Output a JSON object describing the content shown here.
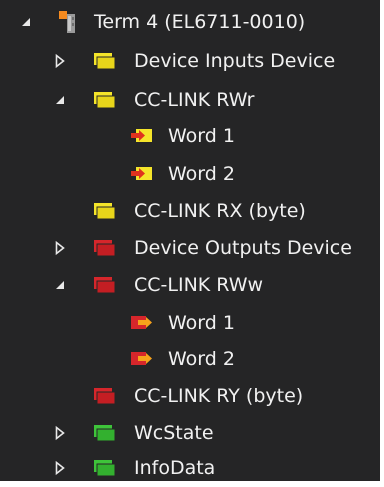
{
  "tree": {
    "root": {
      "label": "Term 4 (EL6711-0010)",
      "expanded": true,
      "icon": "terminal-icon"
    },
    "items": [
      {
        "label": "Device Inputs Device",
        "expanded": false,
        "icon": "yellow-folder-icon"
      },
      {
        "label": "CC-LINK RWr",
        "expanded": true,
        "icon": "yellow-folder-icon"
      },
      {
        "label": "Word 1",
        "icon": "input-variable-icon"
      },
      {
        "label": "Word 2",
        "icon": "input-variable-icon"
      },
      {
        "label": "CC-LINK RX (byte)",
        "icon": "yellow-folder-icon"
      },
      {
        "label": "Device Outputs Device",
        "expanded": false,
        "icon": "red-folder-icon"
      },
      {
        "label": "CC-LINK RWw",
        "expanded": true,
        "icon": "red-folder-icon"
      },
      {
        "label": "Word 1",
        "icon": "output-variable-icon"
      },
      {
        "label": "Word 2",
        "icon": "output-variable-icon"
      },
      {
        "label": "CC-LINK RY (byte)",
        "icon": "red-folder-icon"
      },
      {
        "label": "WcState",
        "expanded": false,
        "icon": "green-folder-icon"
      },
      {
        "label": "InfoData",
        "expanded": false,
        "icon": "green-folder-icon"
      }
    ]
  },
  "colors": {
    "background": "#252526",
    "text": "#f1f1f1",
    "yellow": "#f5e52a",
    "red": "#d6262b",
    "green": "#3ec43a",
    "arrow": "#f7a21b"
  }
}
